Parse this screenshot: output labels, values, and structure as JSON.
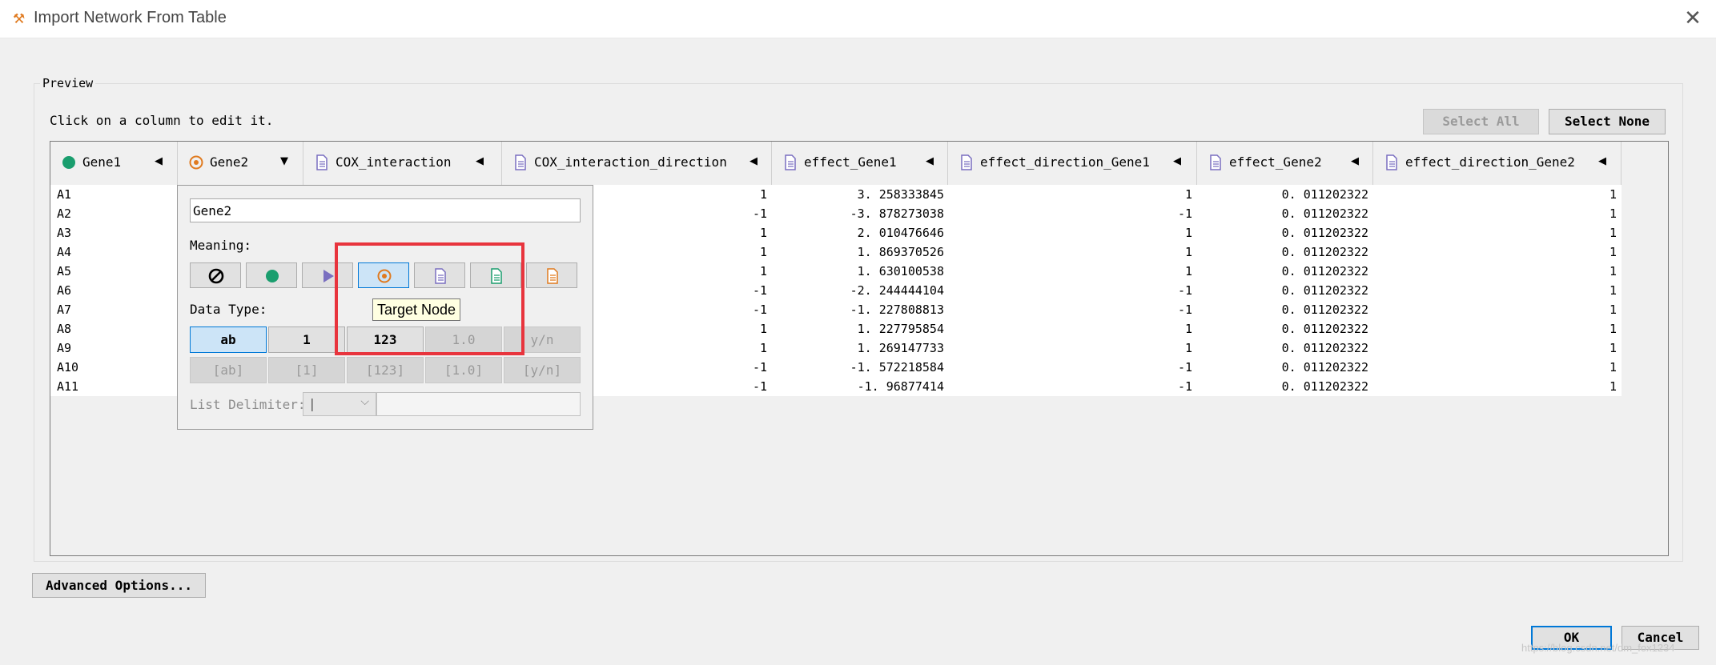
{
  "window": {
    "title": "Import Network From Table",
    "close_icon": "close-icon"
  },
  "preview": {
    "legend": "Preview",
    "hint": "Click on a column to edit it.",
    "select_all_label": "Select All",
    "select_none_label": "Select None"
  },
  "columns": [
    {
      "name": "Gene1",
      "icon": "source-node-icon",
      "arrow": "◀"
    },
    {
      "name": "Gene2",
      "icon": "target-node-icon",
      "arrow": "▼"
    },
    {
      "name": "COX_interaction",
      "icon": "edge-attribute-icon",
      "arrow": "◀"
    },
    {
      "name": "COX_interaction_direction",
      "icon": "edge-attribute-icon",
      "arrow": "◀"
    },
    {
      "name": "effect_Gene1",
      "icon": "edge-attribute-icon",
      "arrow": "◀"
    },
    {
      "name": "effect_direction_Gene1",
      "icon": "edge-attribute-icon",
      "arrow": "◀"
    },
    {
      "name": "effect_Gene2",
      "icon": "edge-attribute-icon",
      "arrow": "◀"
    },
    {
      "name": "effect_direction_Gene2",
      "icon": "edge-attribute-icon",
      "arrow": "◀"
    }
  ],
  "rows": [
    {
      "gene1": "A1",
      "cox_dir": "1",
      "effect1": "3. 258333845",
      "dir1": "1",
      "effect2": "0. 011202322",
      "dir2": "1"
    },
    {
      "gene1": "A2",
      "cox_dir": "-1",
      "effect1": "-3. 878273038",
      "dir1": "-1",
      "effect2": "0. 011202322",
      "dir2": "1"
    },
    {
      "gene1": "A3",
      "cox_dir": "1",
      "effect1": "2. 010476646",
      "dir1": "1",
      "effect2": "0. 011202322",
      "dir2": "1"
    },
    {
      "gene1": "A4",
      "cox_dir": "1",
      "effect1": "1. 869370526",
      "dir1": "1",
      "effect2": "0. 011202322",
      "dir2": "1"
    },
    {
      "gene1": "A5",
      "cox_dir": "1",
      "effect1": "1. 630100538",
      "dir1": "1",
      "effect2": "0. 011202322",
      "dir2": "1"
    },
    {
      "gene1": "A6",
      "cox_dir": "-1",
      "effect1": "-2. 244444104",
      "dir1": "-1",
      "effect2": "0. 011202322",
      "dir2": "1"
    },
    {
      "gene1": "A7",
      "cox_dir": "-1",
      "effect1": "-1. 227808813",
      "dir1": "-1",
      "effect2": "0. 011202322",
      "dir2": "1"
    },
    {
      "gene1": "A8",
      "cox_dir": "1",
      "effect1": "1. 227795854",
      "dir1": "1",
      "effect2": "0. 011202322",
      "dir2": "1"
    },
    {
      "gene1": "A9",
      "cox_dir": "1",
      "effect1": "1. 269147733",
      "dir1": "1",
      "effect2": "0. 011202322",
      "dir2": "1"
    },
    {
      "gene1": "A10",
      "cox_dir": "-1",
      "effect1": "-1. 572218584",
      "dir1": "-1",
      "effect2": "0. 011202322",
      "dir2": "1"
    },
    {
      "gene1": "A11",
      "cox_dir": "-1",
      "effect1": "-1. 96877414",
      "dir1": "-1",
      "effect2": "0. 011202322",
      "dir2": "1"
    }
  ],
  "editor": {
    "column_name": "Gene2",
    "meaning_label": "Meaning:",
    "meaning_buttons": [
      "not-imported-icon",
      "source-node-icon",
      "interaction-type-icon",
      "target-node-icon",
      "edge-attribute-icon",
      "source-node-attribute-icon",
      "target-node-attribute-icon"
    ],
    "data_type_label": "Data Type:",
    "data_types": [
      "ab",
      "1",
      "123",
      "1.0",
      "y/n"
    ],
    "list_types": [
      "[ab]",
      "[1]",
      "[123]",
      "[1.0]",
      "[y/n]"
    ],
    "list_delimiter_label": "List Delimiter:",
    "list_delimiter_value": "|",
    "tooltip": "Target Node"
  },
  "footer": {
    "advanced_label": "Advanced Options...",
    "ok_label": "OK",
    "cancel_label": "Cancel",
    "watermark": "https://blog.csdn.net/dm_fox1234"
  },
  "colors": {
    "source": "#1a9e6e",
    "target": "#e07a1f",
    "interaction": "#7a6fc0",
    "edge": "#7a6fc0",
    "highlight": "#e8343d",
    "selected": "#cce4f7"
  }
}
